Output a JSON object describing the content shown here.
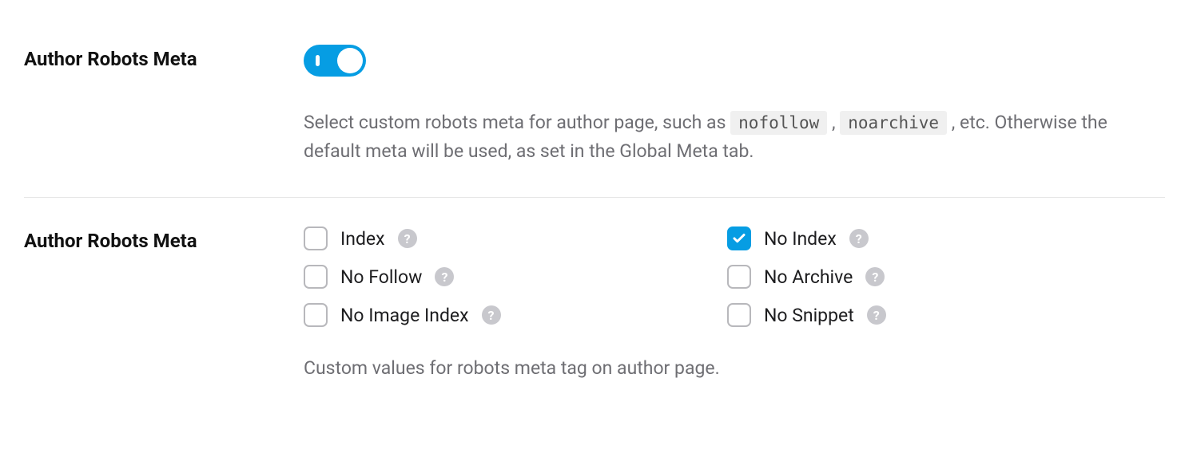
{
  "section1": {
    "label": "Author Robots Meta",
    "toggle_on": true,
    "desc_pre": "Select custom robots meta for author page, such as ",
    "code1": "nofollow",
    "sep": ", ",
    "code2": "noarchive",
    "desc_post": ", etc. Otherwise the default meta will be used, as set in the Global Meta tab."
  },
  "section2": {
    "label": "Author Robots Meta",
    "options": [
      {
        "label": "Index",
        "checked": false
      },
      {
        "label": "No Index",
        "checked": true
      },
      {
        "label": "No Follow",
        "checked": false
      },
      {
        "label": "No Archive",
        "checked": false
      },
      {
        "label": "No Image Index",
        "checked": false
      },
      {
        "label": "No Snippet",
        "checked": false
      }
    ],
    "desc": "Custom values for robots meta tag on author page."
  }
}
